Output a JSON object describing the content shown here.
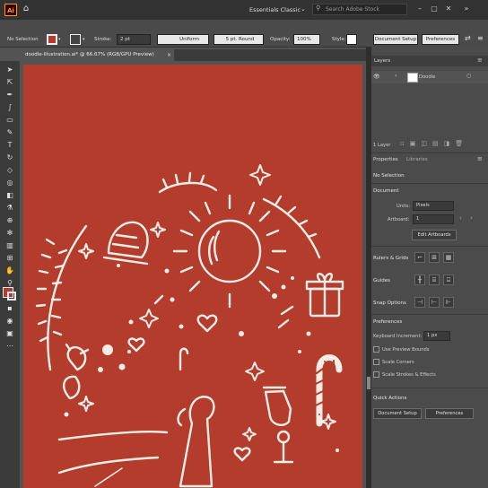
{
  "app": {
    "logo": "Ai",
    "workspace": "Essentials Classic",
    "search_placeholder": "Search Adobe Stock"
  },
  "control_bar": {
    "selection_label": "No Selection",
    "stroke_label": "Stroke:",
    "stroke_value": "2 pt",
    "profile_value": "Uniform",
    "brush_value": "5 pt. Round",
    "opacity_label": "Opacity:",
    "opacity_value": "100%",
    "style_label": "Style:",
    "document_setup": "Document Setup",
    "preferences": "Preferences"
  },
  "document_tab": {
    "title": "doodle-illustration.ai* @ 66.67% (RGB/GPU Preview)",
    "close": "×"
  },
  "layers_panel": {
    "tab": "Layers",
    "layer_name": "Doodle",
    "count": "1 Layer"
  },
  "properties_panel": {
    "tabs": [
      "Properties",
      "Libraries"
    ],
    "no_selection": "No Selection",
    "document_title": "Document",
    "units_label": "Units:",
    "units_value": "Pixels",
    "artboard_label": "Artboard:",
    "artboard_value": "1",
    "edit_artboards": "Edit Artboards",
    "rulers_grids": "Rulers & Grids",
    "guides": "Guides",
    "snap_options": "Snap Options",
    "preferences_title": "Preferences",
    "keyboard_increment_label": "Keyboard Increment:",
    "keyboard_increment_value": "1 px",
    "checkboxes": [
      "Use Preview Bounds",
      "Scale Corners",
      "Scale Strokes & Effects"
    ],
    "quick_actions": "Quick Actions",
    "document_setup": "Document Setup",
    "preferences_btn": "Preferences"
  },
  "colors": {
    "artboard": "#b33c2c",
    "ui_dark": "#323232",
    "panel": "#4b4b4b",
    "accent": "#ff9a00"
  }
}
